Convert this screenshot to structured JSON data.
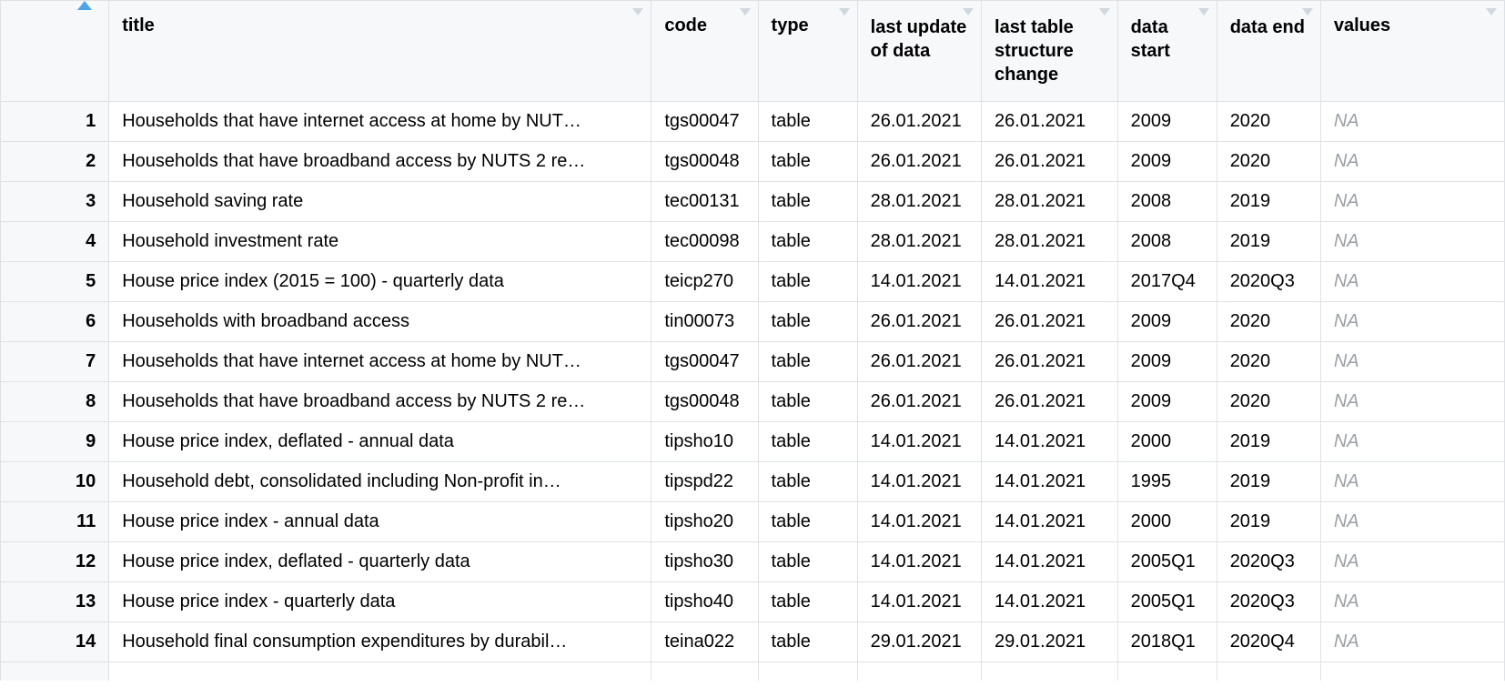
{
  "columns": {
    "rownum": "",
    "title": "title",
    "code": "code",
    "type": "type",
    "last_update": "last update of data",
    "last_structure": "last table structure change",
    "data_start": "data start",
    "data_end": "data end",
    "values": "values"
  },
  "na_label": "NA",
  "rows": [
    {
      "n": "1",
      "title": "Households that have internet access at home by NUT…",
      "code": "tgs00047",
      "type": "table",
      "last_update": "26.01.2021",
      "last_structure": "26.01.2021",
      "data_start": "2009",
      "data_end": "2020",
      "values": "NA"
    },
    {
      "n": "2",
      "title": "Households that have broadband access by NUTS 2 re…",
      "code": "tgs00048",
      "type": "table",
      "last_update": "26.01.2021",
      "last_structure": "26.01.2021",
      "data_start": "2009",
      "data_end": "2020",
      "values": "NA"
    },
    {
      "n": "3",
      "title": "Household saving rate",
      "code": "tec00131",
      "type": "table",
      "last_update": "28.01.2021",
      "last_structure": "28.01.2021",
      "data_start": "2008",
      "data_end": "2019",
      "values": "NA"
    },
    {
      "n": "4",
      "title": "Household investment rate",
      "code": "tec00098",
      "type": "table",
      "last_update": "28.01.2021",
      "last_structure": "28.01.2021",
      "data_start": "2008",
      "data_end": "2019",
      "values": "NA"
    },
    {
      "n": "5",
      "title": "House price index (2015 = 100) - quarterly data",
      "code": "teicp270",
      "type": "table",
      "last_update": "14.01.2021",
      "last_structure": "14.01.2021",
      "data_start": "2017Q4",
      "data_end": "2020Q3",
      "values": "NA"
    },
    {
      "n": "6",
      "title": "Households with broadband access",
      "code": "tin00073",
      "type": "table",
      "last_update": "26.01.2021",
      "last_structure": "26.01.2021",
      "data_start": "2009",
      "data_end": "2020",
      "values": "NA"
    },
    {
      "n": "7",
      "title": "Households that have internet access at home by NUT…",
      "code": "tgs00047",
      "type": "table",
      "last_update": "26.01.2021",
      "last_structure": "26.01.2021",
      "data_start": "2009",
      "data_end": "2020",
      "values": "NA"
    },
    {
      "n": "8",
      "title": "Households that have broadband access by NUTS 2 re…",
      "code": "tgs00048",
      "type": "table",
      "last_update": "26.01.2021",
      "last_structure": "26.01.2021",
      "data_start": "2009",
      "data_end": "2020",
      "values": "NA"
    },
    {
      "n": "9",
      "title": "House price index, deflated - annual data",
      "code": "tipsho10",
      "type": "table",
      "last_update": "14.01.2021",
      "last_structure": "14.01.2021",
      "data_start": "2000",
      "data_end": "2019",
      "values": "NA"
    },
    {
      "n": "10",
      "title": "Household debt, consolidated including Non-profit in…",
      "code": "tipspd22",
      "type": "table",
      "last_update": "14.01.2021",
      "last_structure": "14.01.2021",
      "data_start": "1995",
      "data_end": "2019",
      "values": "NA"
    },
    {
      "n": "11",
      "title": "House price index - annual data",
      "code": "tipsho20",
      "type": "table",
      "last_update": "14.01.2021",
      "last_structure": "14.01.2021",
      "data_start": "2000",
      "data_end": "2019",
      "values": "NA"
    },
    {
      "n": "12",
      "title": "House price index, deflated - quarterly data",
      "code": "tipsho30",
      "type": "table",
      "last_update": "14.01.2021",
      "last_structure": "14.01.2021",
      "data_start": "2005Q1",
      "data_end": "2020Q3",
      "values": "NA"
    },
    {
      "n": "13",
      "title": "House price index - quarterly data",
      "code": "tipsho40",
      "type": "table",
      "last_update": "14.01.2021",
      "last_structure": "14.01.2021",
      "data_start": "2005Q1",
      "data_end": "2020Q3",
      "values": "NA"
    },
    {
      "n": "14",
      "title": "Household final consumption expenditures by durabil…",
      "code": "teina022",
      "type": "table",
      "last_update": "29.01.2021",
      "last_structure": "29.01.2021",
      "data_start": "2018Q1",
      "data_end": "2020Q4",
      "values": "NA"
    }
  ]
}
